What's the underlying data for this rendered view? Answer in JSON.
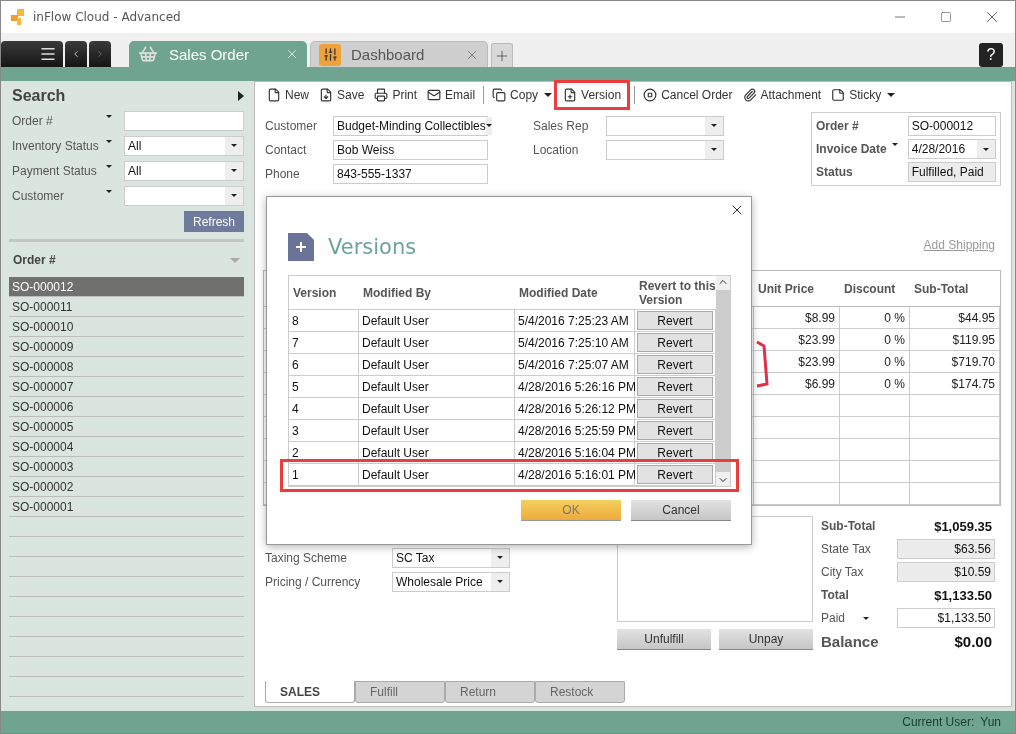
{
  "window": {
    "title": "inFlow Cloud - Advanced"
  },
  "tabs": [
    {
      "label": "Sales Order",
      "selected": true,
      "kind": "sales"
    },
    {
      "label": "Dashboard",
      "selected": false,
      "kind": "dashboard"
    }
  ],
  "help_button": "?",
  "sidebar": {
    "title": "Search",
    "filters": [
      {
        "label": "Order #",
        "kind": "text"
      },
      {
        "label": "Inventory Status",
        "kind": "dropdown",
        "value": "All"
      },
      {
        "label": "Payment Status",
        "kind": "dropdown",
        "value": "All"
      },
      {
        "label": "Customer",
        "kind": "dropdown"
      }
    ],
    "refresh_button": "Refresh",
    "list_header": "Order #",
    "orders": [
      {
        "number": "SO-000012",
        "selected": true
      },
      {
        "number": "SO-000011",
        "selected": false
      },
      {
        "number": "SO-000010",
        "selected": false
      },
      {
        "number": "SO-000009",
        "selected": false
      },
      {
        "number": "SO-000008",
        "selected": false
      },
      {
        "number": "SO-000007",
        "selected": false
      },
      {
        "number": "SO-000006",
        "selected": false
      },
      {
        "number": "SO-000005",
        "selected": false
      },
      {
        "number": "SO-000004",
        "selected": false
      },
      {
        "number": "SO-000003",
        "selected": false
      },
      {
        "number": "SO-000002",
        "selected": false
      },
      {
        "number": "SO-000001",
        "selected": false
      }
    ]
  },
  "toolbar": [
    {
      "label": "New",
      "kind": "new",
      "caret": false,
      "highlighted": false
    },
    {
      "label": "Save",
      "kind": "save",
      "caret": false,
      "highlighted": false
    },
    {
      "label": "Print",
      "kind": "print",
      "caret": false,
      "highlighted": false
    },
    {
      "label": "Email",
      "kind": "email",
      "caret": false,
      "highlighted": false
    },
    {
      "label": "Copy",
      "kind": "copy",
      "caret": true,
      "highlighted": false
    },
    {
      "label": "Version",
      "kind": "version",
      "caret": false,
      "highlighted": true
    },
    {
      "label": "Cancel Order",
      "kind": "cancel",
      "caret": false,
      "highlighted": false
    },
    {
      "label": "Attachment",
      "kind": "attachment",
      "caret": false,
      "highlighted": false
    },
    {
      "label": "Sticky",
      "kind": "sticky",
      "caret": true,
      "highlighted": false
    }
  ],
  "order_form": {
    "left_fields": [
      {
        "label": "Customer",
        "value": "Budget-Minding Collectibles",
        "kind": "dropdown"
      },
      {
        "label": "Contact",
        "value": "Bob Weiss",
        "kind": "text"
      },
      {
        "label": "Phone",
        "value": "843-555-1337",
        "kind": "text"
      }
    ],
    "middle_fields": [
      {
        "label": "Sales Rep",
        "kind": "dropdown"
      },
      {
        "label": "Location",
        "kind": "dropdown"
      }
    ],
    "summary": [
      {
        "label": "Order #",
        "value": "SO-000012",
        "kind": "text"
      },
      {
        "label": "Invoice Date",
        "value": "4/28/2016",
        "kind": "date"
      },
      {
        "label": "Status",
        "value": "Fulfilled, Paid",
        "kind": "readonly"
      }
    ],
    "add_shipping_link": "Add Shipping"
  },
  "items_table": {
    "columns": [
      "Unit Price",
      "Discount",
      "Sub-Total"
    ],
    "rows": [
      [
        "$8.99",
        "0 %",
        "$44.95"
      ],
      [
        "$23.99",
        "0 %",
        "$119.95"
      ],
      [
        "$23.99",
        "0 %",
        "$719.70"
      ],
      [
        "$6.99",
        "0 %",
        "$174.75"
      ]
    ]
  },
  "bottom_fields": [
    {
      "label": "Taxing Scheme",
      "value": "SC Tax"
    },
    {
      "label": "Pricing / Currency",
      "value": "Wholesale Price"
    }
  ],
  "action_buttons": [
    "Unfulfill",
    "Unpay"
  ],
  "totals": [
    {
      "label": "Sub-Total",
      "value": "$1,059.35",
      "kind": "bold"
    },
    {
      "label": "State Tax",
      "value": "$63.56",
      "kind": "readonly"
    },
    {
      "label": "City Tax",
      "value": "$10.59",
      "kind": "readonly"
    },
    {
      "label": "Total",
      "value": "$1,133.50",
      "kind": "bold"
    },
    {
      "label": "Paid",
      "value": "$1,133.50",
      "kind": "input"
    },
    {
      "label": "Balance",
      "value": "$0.00",
      "kind": "balance"
    }
  ],
  "bottom_tabs": [
    {
      "label": "SALES",
      "selected": true
    },
    {
      "label": "Fulfill",
      "selected": false
    },
    {
      "label": "Return",
      "selected": false
    },
    {
      "label": "Restock",
      "selected": false
    }
  ],
  "status_bar": {
    "label": "Current User:",
    "user": "Yun"
  },
  "dialog": {
    "title": "Versions",
    "columns": [
      "Version",
      "Modified By",
      "Modified Date",
      "Revert to this Version"
    ],
    "rows": [
      {
        "version": "8",
        "modified_by": "Default User",
        "modified_date": "5/4/2016 7:25:23 AM",
        "action": "Revert",
        "highlighted": false
      },
      {
        "version": "7",
        "modified_by": "Default User",
        "modified_date": "5/4/2016 7:25:10 AM",
        "action": "Revert",
        "highlighted": false
      },
      {
        "version": "6",
        "modified_by": "Default User",
        "modified_date": "5/4/2016 7:25:07 AM",
        "action": "Revert",
        "highlighted": false
      },
      {
        "version": "5",
        "modified_by": "Default User",
        "modified_date": "4/28/2016 5:26:16 PM",
        "action": "Revert",
        "highlighted": false
      },
      {
        "version": "4",
        "modified_by": "Default User",
        "modified_date": "4/28/2016 5:26:12 PM",
        "action": "Revert",
        "highlighted": false
      },
      {
        "version": "3",
        "modified_by": "Default User",
        "modified_date": "4/28/2016 5:25:59 PM",
        "action": "Revert",
        "highlighted": false
      },
      {
        "version": "2",
        "modified_by": "Default User",
        "modified_date": "4/28/2016 5:16:04 PM",
        "action": "Revert",
        "highlighted": false
      },
      {
        "version": "1",
        "modified_by": "Default User",
        "modified_date": "4/28/2016 5:16:01 PM",
        "action": "Revert",
        "highlighted": true
      }
    ],
    "buttons": [
      {
        "label": "OK",
        "kind": "primary"
      },
      {
        "label": "Cancel",
        "kind": "secondary"
      }
    ]
  }
}
